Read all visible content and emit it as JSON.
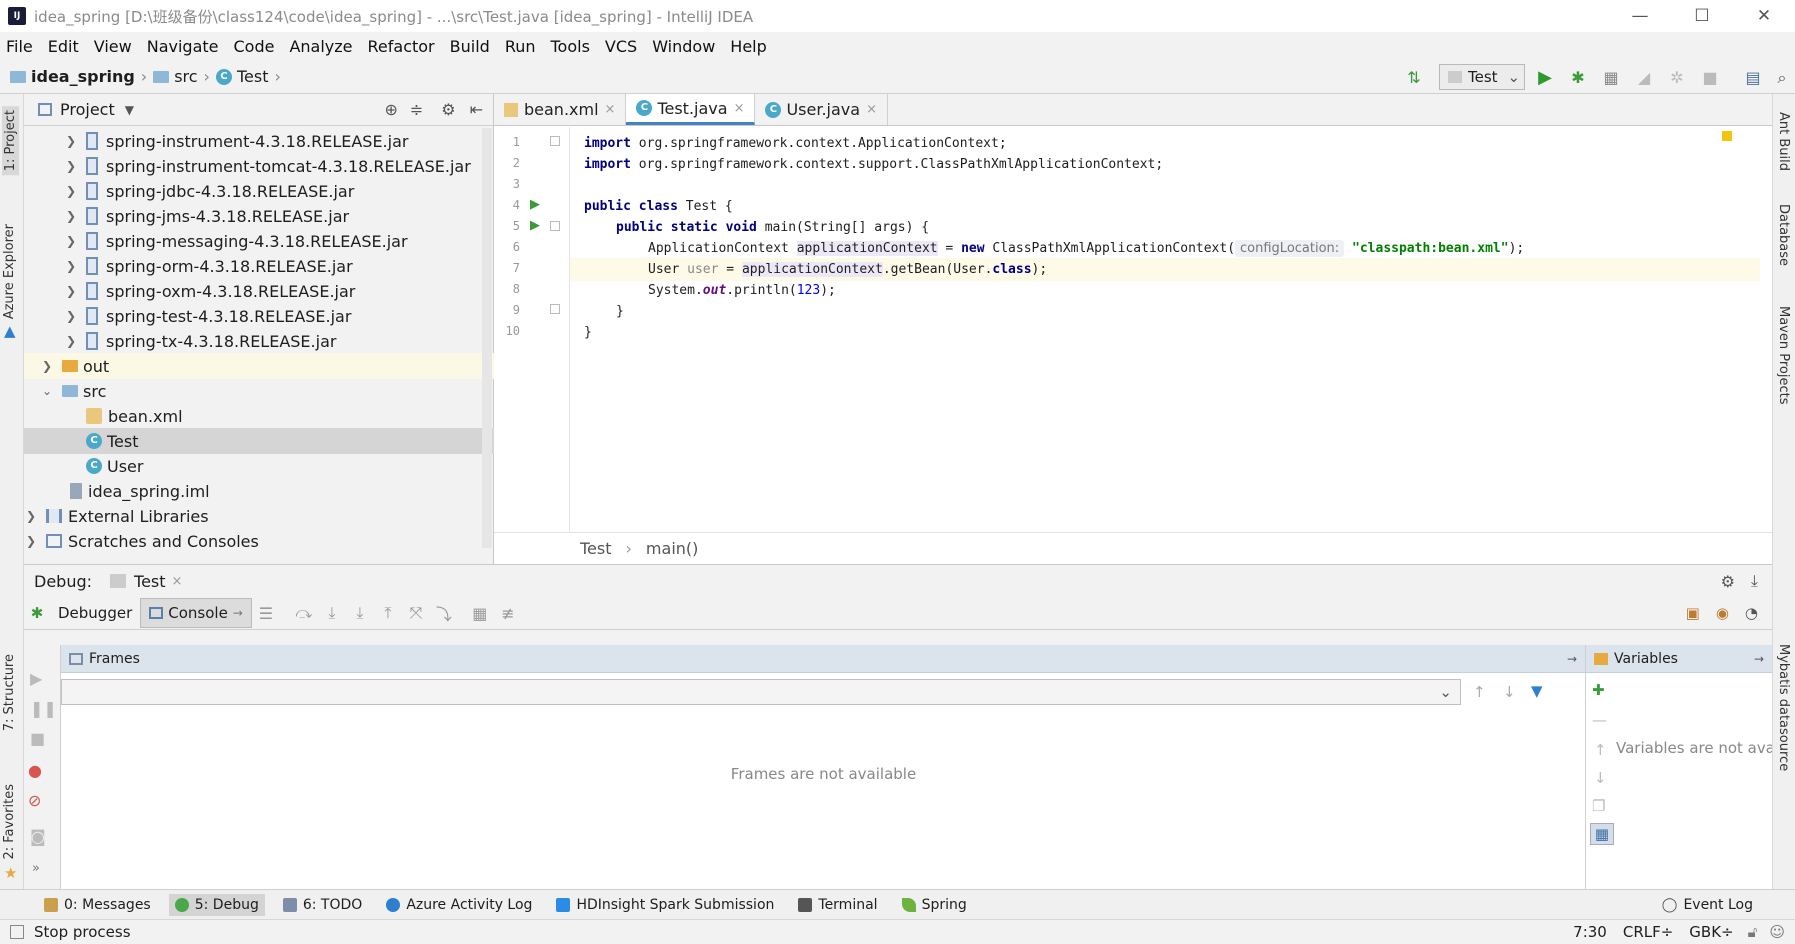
{
  "window": {
    "title": "idea_spring [D:\\班级备份\\class124\\code\\idea_spring] - ...\\src\\Test.java [idea_spring] - IntelliJ IDEA",
    "controls": [
      "—",
      "☐",
      "✕"
    ]
  },
  "menu": [
    "File",
    "Edit",
    "View",
    "Navigate",
    "Code",
    "Analyze",
    "Refactor",
    "Build",
    "Run",
    "Tools",
    "VCS",
    "Window",
    "Help"
  ],
  "breadcrumb": {
    "project": "idea_spring",
    "folder": "src",
    "file": "Test"
  },
  "run_config": "Test",
  "left_strip": {
    "project_tab": "1: Project",
    "azure_tab": "Azure Explorer",
    "structure_tab": "7: Structure",
    "favorites_tab": "2: Favorites"
  },
  "right_strip": {
    "ant": "Ant Build",
    "database": "Database",
    "maven": "Maven Projects",
    "mybatis": "Mybatis datasource"
  },
  "project_panel": {
    "title": "Project",
    "items": [
      {
        "label": "spring-instrument-4.3.18.RELEASE.jar",
        "type": "jar",
        "indent": 2
      },
      {
        "label": "spring-instrument-tomcat-4.3.18.RELEASE.jar",
        "type": "jar",
        "indent": 2
      },
      {
        "label": "spring-jdbc-4.3.18.RELEASE.jar",
        "type": "jar",
        "indent": 2
      },
      {
        "label": "spring-jms-4.3.18.RELEASE.jar",
        "type": "jar",
        "indent": 2
      },
      {
        "label": "spring-messaging-4.3.18.RELEASE.jar",
        "type": "jar",
        "indent": 2
      },
      {
        "label": "spring-orm-4.3.18.RELEASE.jar",
        "type": "jar",
        "indent": 2
      },
      {
        "label": "spring-oxm-4.3.18.RELEASE.jar",
        "type": "jar",
        "indent": 2
      },
      {
        "label": "spring-test-4.3.18.RELEASE.jar",
        "type": "jar",
        "indent": 2
      },
      {
        "label": "spring-tx-4.3.18.RELEASE.jar",
        "type": "jar",
        "indent": 2
      },
      {
        "label": "out",
        "type": "folder-orange",
        "indent": 1
      },
      {
        "label": "src",
        "type": "folder",
        "indent": 1
      },
      {
        "label": "bean.xml",
        "type": "xml",
        "indent": 2
      },
      {
        "label": "Test",
        "type": "class",
        "indent": 2
      },
      {
        "label": "User",
        "type": "class",
        "indent": 2
      },
      {
        "label": "idea_spring.iml",
        "type": "iml",
        "indent": 1
      },
      {
        "label": "External Libraries",
        "type": "lib",
        "indent": 0
      },
      {
        "label": "Scratches and Consoles",
        "type": "scratch",
        "indent": 0
      }
    ]
  },
  "editor": {
    "tabs": [
      {
        "label": "bean.xml",
        "active": false
      },
      {
        "label": "Test.java",
        "active": true
      },
      {
        "label": "User.java",
        "active": false
      }
    ],
    "line_numbers": [
      "1",
      "2",
      "3",
      "4",
      "5",
      "6",
      "7",
      "8",
      "9",
      "10"
    ],
    "code": {
      "l1_kw": "import",
      "l1_rest": " org.springframework.context.ApplicationContext;",
      "l2_kw": "import",
      "l2_rest": " org.springframework.context.support.ClassPathXmlApplicationContext;",
      "l4_kw": "public class",
      "l4_rest": " Test {",
      "l5_kw": "public static void",
      "l5_rest": " main(String[] args) {",
      "l6_a": "ApplicationContext ",
      "l6_var": "applicationContext",
      "l6_b": " = ",
      "l6_new": "new",
      "l6_c": " ClassPathXmlApplicationContext(",
      "l6_hint": "configLocation:",
      "l6_str": "\"classpath:bean.xml\"",
      "l6_d": ");",
      "l7_a": "User ",
      "l7_var": "user",
      "l7_b": " = ",
      "l7_ref": "applicationContext",
      "l7_c": ".getBean(User.",
      "l7_kw": "class",
      "l7_d": ");",
      "l8_a": "System.",
      "l8_out": "out",
      "l8_b": ".println(",
      "l8_num": "123",
      "l8_c": ");",
      "l9": "}",
      "l10": "}"
    },
    "crumbs": [
      "Test",
      "main()"
    ]
  },
  "debug": {
    "label": "Debug:",
    "session_tab": "Test",
    "tabs": {
      "debugger": "Debugger",
      "console": "Console"
    },
    "frames_title": "Frames",
    "frames_empty": "Frames are not available",
    "variables_title": "Variables",
    "variables_empty": "Variables are not available"
  },
  "bottom_tools": [
    {
      "label": "0: Messages",
      "color": "#c9a04b"
    },
    {
      "label": "5: Debug",
      "color": "#4aa84a",
      "active": true
    },
    {
      "label": "6: TODO",
      "color": "#7d8ea8"
    },
    {
      "label": "Azure Activity Log",
      "color": "#2f7fd0"
    },
    {
      "label": "HDInsight Spark Submission",
      "color": "#2b8ce8"
    },
    {
      "label": "Terminal",
      "color": "#555555"
    },
    {
      "label": "Spring",
      "color": "#6db33f"
    },
    {
      "label": "Event Log",
      "color": "#777777"
    }
  ],
  "status": {
    "message": "Stop process",
    "position": "7:30",
    "line_sep": "CRLF÷",
    "encoding": "GBK÷"
  }
}
